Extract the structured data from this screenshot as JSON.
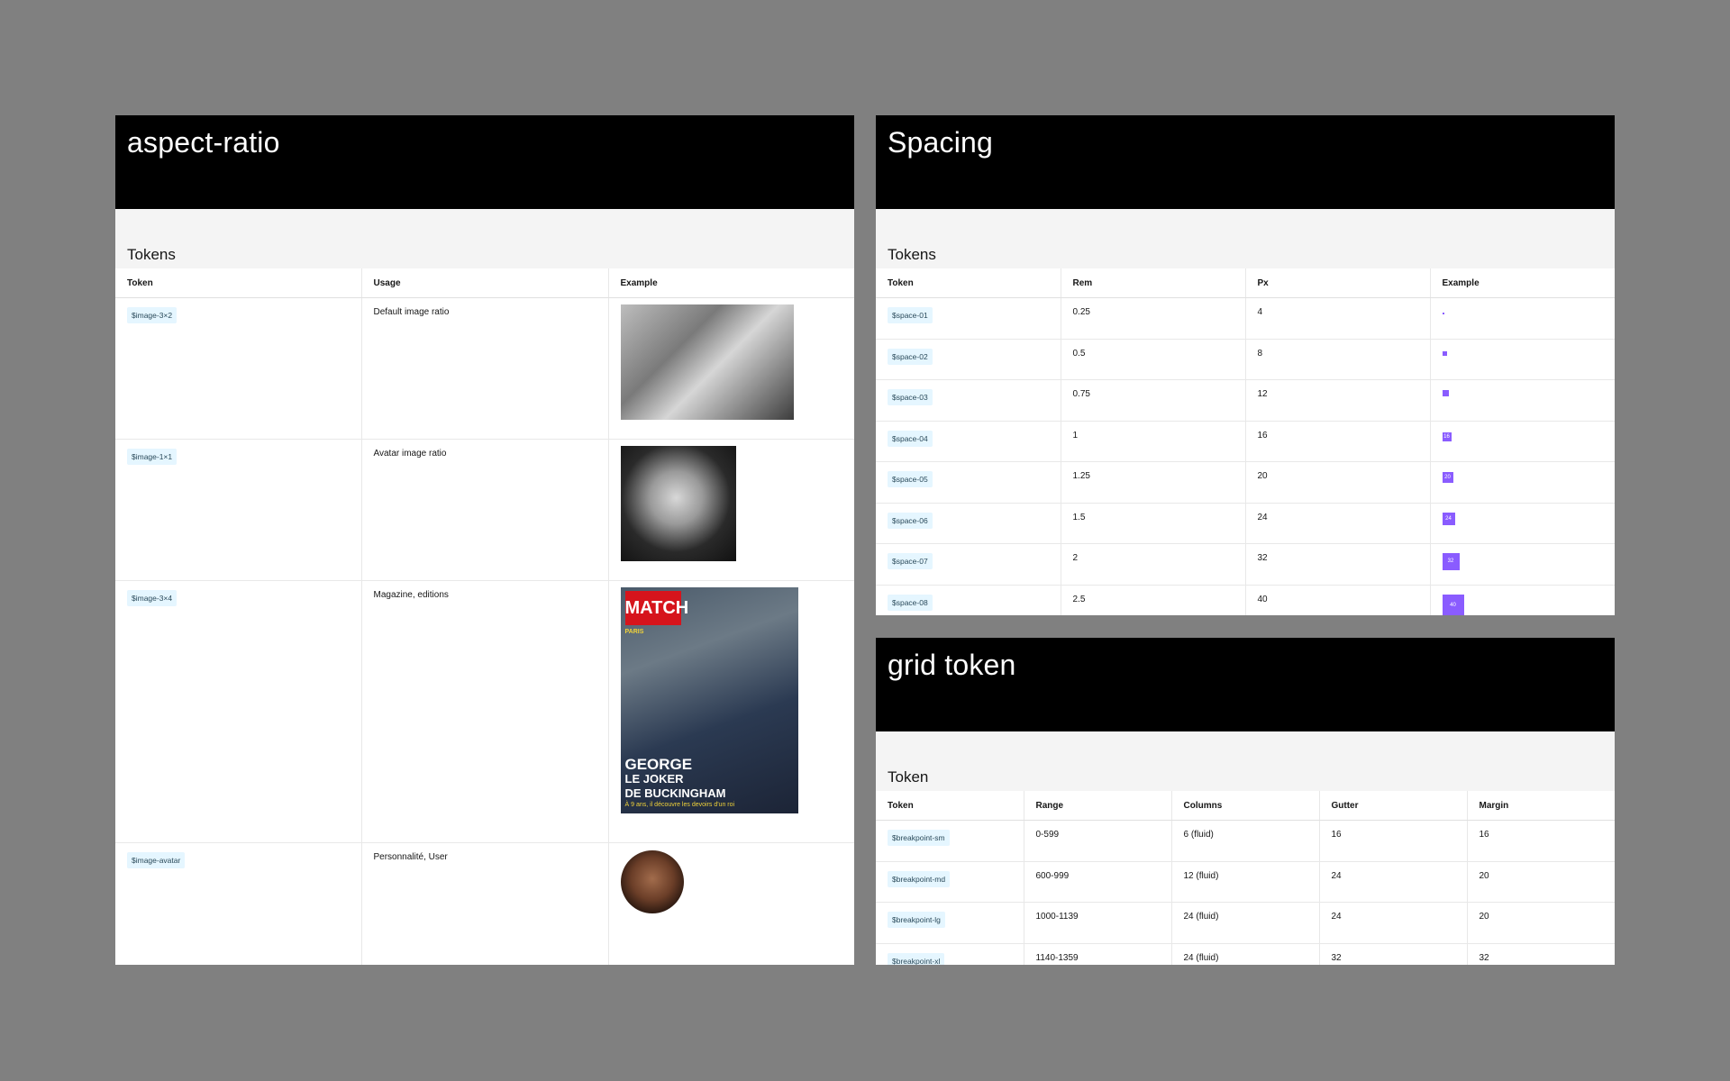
{
  "aspect": {
    "title": "aspect-ratio",
    "subtitle": "Tokens",
    "headers": [
      "Token",
      "Usage",
      "Example"
    ],
    "rows": [
      {
        "token": "$image-3×2",
        "usage": "Default image ratio"
      },
      {
        "token": "$image-1×1",
        "usage": "Avatar image ratio"
      },
      {
        "token": "$image-3×4",
        "usage": "Magazine, editions"
      },
      {
        "token": "$image-avatar",
        "usage": "Personnalité, User"
      }
    ],
    "magazine": {
      "logo": "MATCH",
      "kicker": "PARIS",
      "headline_1": "GEORGE",
      "headline_2": "LE JOKER",
      "headline_3": "DE BUCKINGHAM",
      "subline": "À 9 ans, il découvre les devoirs d'un roi"
    }
  },
  "spacing": {
    "title": "Spacing",
    "subtitle": "Tokens",
    "headers": [
      "Token",
      "Rem",
      "Px",
      "Example"
    ],
    "rows": [
      {
        "token": "$space-01",
        "rem": "0.25",
        "px": "4",
        "label": ""
      },
      {
        "token": "$space-02",
        "rem": "0.5",
        "px": "8",
        "label": ""
      },
      {
        "token": "$space-03",
        "rem": "0.75",
        "px": "12",
        "label": ""
      },
      {
        "token": "$space-04",
        "rem": "1",
        "px": "16",
        "label": "16"
      },
      {
        "token": "$space-05",
        "rem": "1.25",
        "px": "20",
        "label": "20"
      },
      {
        "token": "$space-06",
        "rem": "1.5",
        "px": "24",
        "label": "24"
      },
      {
        "token": "$space-07",
        "rem": "2",
        "px": "32",
        "label": "32"
      },
      {
        "token": "$space-08",
        "rem": "2.5",
        "px": "40",
        "label": "40"
      }
    ]
  },
  "grid": {
    "title": "grid token",
    "subtitle": "Token",
    "headers": [
      "Token",
      "Range",
      "Columns",
      "Gutter",
      "Margin"
    ],
    "rows": [
      {
        "token": "$breakpoint-sm",
        "range": "0-599",
        "columns": "6 (fluid)",
        "gutter": "16",
        "margin": "16"
      },
      {
        "token": "$breakpoint-md",
        "range": "600-999",
        "columns": "12 (fluid)",
        "gutter": "24",
        "margin": "20"
      },
      {
        "token": "$breakpoint-lg",
        "range": "1000-1139",
        "columns": "24 (fluid)",
        "gutter": "24",
        "margin": "20"
      },
      {
        "token": "$breakpoint-xl",
        "range": "1140-1359",
        "columns": "24 (fluid)",
        "gutter": "32",
        "margin": "32"
      }
    ]
  },
  "colors": {
    "accent": "#8a5cff",
    "tag_bg": "#e5f6ff",
    "background": "#808080"
  }
}
